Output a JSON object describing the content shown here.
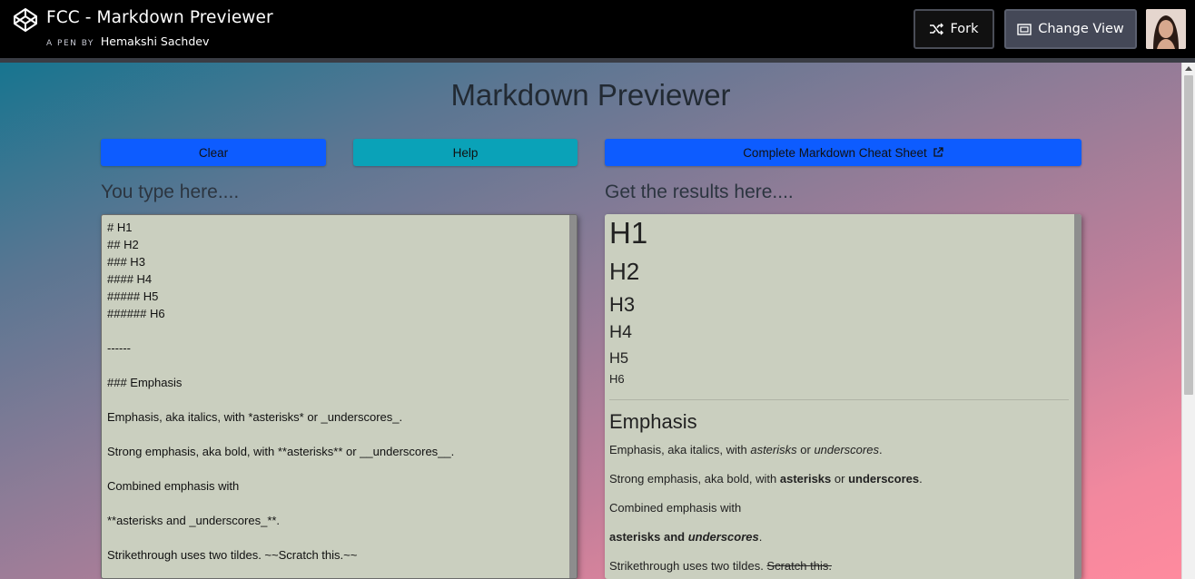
{
  "header": {
    "pen_title": "FCC - Markdown Previewer",
    "pen_by_prefix": "A PEN BY",
    "author": "Hemakshi Sachdev",
    "fork_label": "Fork",
    "change_view_label": "Change View"
  },
  "app": {
    "title": "Markdown Previewer",
    "buttons": {
      "clear": "Clear",
      "help": "Help",
      "cheat_sheet": "Complete Markdown Cheat Sheet"
    },
    "editor_label": "You type here....",
    "preview_label": "Get the results here....",
    "editor_text": "# H1\n## H2\n### H3\n#### H4\n##### H5\n###### H6\n\n------\n\n### Emphasis\n\nEmphasis, aka italics, with *asterisks* or _underscores_.\n\nStrong emphasis, aka bold, with **asterisks** or __underscores__.\n\nCombined emphasis with\n\n**asterisks and _underscores_**.\n\nStrikethrough uses two tildes. ~~Scratch this.~~",
    "preview": {
      "h1": "H1",
      "h2": "H2",
      "h3": "H3",
      "h4": "H4",
      "h5": "H5",
      "h6": "H6",
      "emphasis_heading": "Emphasis",
      "p1": {
        "prefix": "Emphasis, aka italics, with ",
        "em1": "asterisks",
        "mid": " or ",
        "em2": "underscores",
        "suffix": "."
      },
      "p2": {
        "prefix": "Strong emphasis, aka bold, with ",
        "strong1": "asterisks",
        "mid": " or ",
        "strong2": "underscores",
        "suffix": "."
      },
      "p3": "Combined emphasis with",
      "p4": {
        "strong": "asterisks and ",
        "strong_em": "underscores",
        "suffix": "."
      },
      "p5": {
        "prefix": "Strikethrough uses two tildes. ",
        "strike": "Scratch this."
      }
    }
  },
  "colors": {
    "primary_button": "#0d5cff",
    "help_button": "#0aa2b8",
    "panel_bg": "#cacfbf"
  }
}
